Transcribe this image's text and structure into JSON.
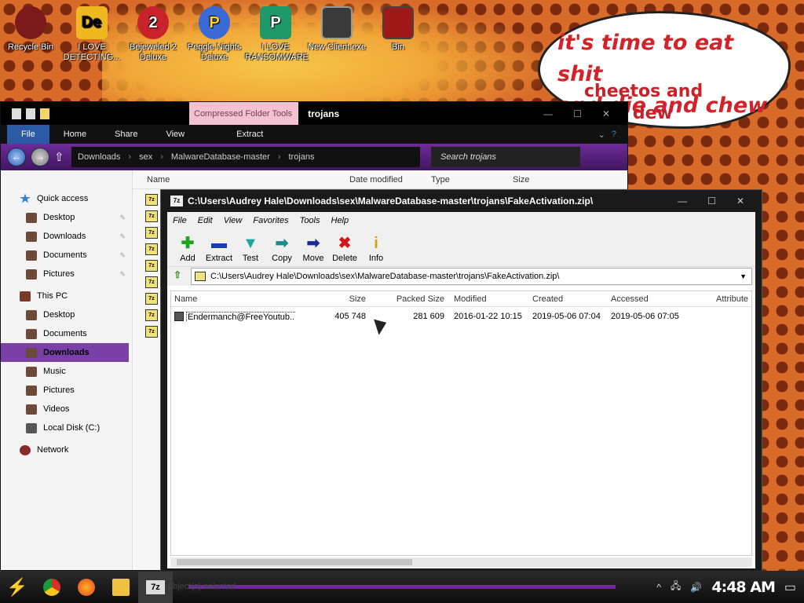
{
  "desktop": {
    "icons": [
      {
        "label": "Recycle Bin",
        "glyph": "",
        "color": "#7a1a1a"
      },
      {
        "label": "I LOVE DETECTING...",
        "glyph": "De",
        "color": "#f0b820"
      },
      {
        "label": "Bejeweled 2 Deluxe",
        "glyph": "2",
        "color": "#c8232a"
      },
      {
        "label": "Peggle Nights Deluxe",
        "glyph": "P",
        "color": "#3a6ad6"
      },
      {
        "label": "I LOVE RANSOMWARE",
        "glyph": "P",
        "color": "#1e9a6a"
      },
      {
        "label": "New Client.exe",
        "glyph": "",
        "color": "#3a3a3a"
      },
      {
        "label": "Bin",
        "glyph": "",
        "color": "#a01818"
      }
    ],
    "bubble_line1": "it's time to eat shit",
    "bubble_line2": "and die and chew",
    "bubble_line3": "cheetos and",
    "bubble_line4": "ntain dew"
  },
  "explorer": {
    "tools_tab": "Compressed Folder Tools",
    "title": "trojans",
    "ribbon": {
      "file": "File",
      "home": "Home",
      "share": "Share",
      "view": "View",
      "extract": "Extract"
    },
    "breadcrumb": [
      "Downloads",
      "sex",
      "MalwareDatabase-master",
      "trojans"
    ],
    "search_placeholder": "Search trojans",
    "columns": {
      "name": "Name",
      "date": "Date modified",
      "type": "Type",
      "size": "Size"
    },
    "nav": {
      "quick_access": "Quick access",
      "qa_items": [
        "Desktop",
        "Downloads",
        "Documents",
        "Pictures"
      ],
      "this_pc": "This PC",
      "pc_items": [
        "Desktop",
        "Documents",
        "Downloads",
        "Music",
        "Pictures",
        "Videos",
        "Local Disk (C:)"
      ],
      "network": "Network"
    }
  },
  "sevenzip": {
    "title": "C:\\Users\\Audrey Hale\\Downloads\\sex\\MalwareDatabase-master\\trojans\\FakeActivation.zip\\",
    "menu": [
      "File",
      "Edit",
      "View",
      "Favorites",
      "Tools",
      "Help"
    ],
    "toolbar": [
      {
        "label": "Add",
        "glyph": "✚",
        "color": "#1aa51a"
      },
      {
        "label": "Extract",
        "glyph": "▬",
        "color": "#1a3ab8"
      },
      {
        "label": "Test",
        "glyph": "▼",
        "color": "#1aa8a0"
      },
      {
        "label": "Copy",
        "glyph": "➡",
        "color": "#1a8a8a"
      },
      {
        "label": "Move",
        "glyph": "➡",
        "color": "#1a2a9a"
      },
      {
        "label": "Delete",
        "glyph": "✖",
        "color": "#d01a1a"
      },
      {
        "label": "Info",
        "glyph": "i",
        "color": "#d8a010"
      }
    ],
    "path": "C:\\Users\\Audrey Hale\\Downloads\\sex\\MalwareDatabase-master\\trojans\\FakeActivation.zip\\",
    "columns": [
      "Name",
      "Size",
      "Packed Size",
      "Modified",
      "Created",
      "Accessed",
      "Attribute"
    ],
    "rows": [
      {
        "name": "Endermanch@FreeYoutub...",
        "size": "405 748",
        "packed": "281 609",
        "modified": "2016-01-22 10:15",
        "created": "2019-05-06 07:04",
        "accessed": "2019-05-06 07:05",
        "attr": ""
      }
    ],
    "status": "object(s) selected"
  },
  "taskbar": {
    "clock": "4:48 AM",
    "apps": [
      {
        "name": "chrome",
        "color": "#2a9a3a"
      },
      {
        "name": "firefox",
        "color": "#e86a1a"
      },
      {
        "name": "file-explorer",
        "color": "#f0c040"
      }
    ],
    "active_app": "7z"
  }
}
